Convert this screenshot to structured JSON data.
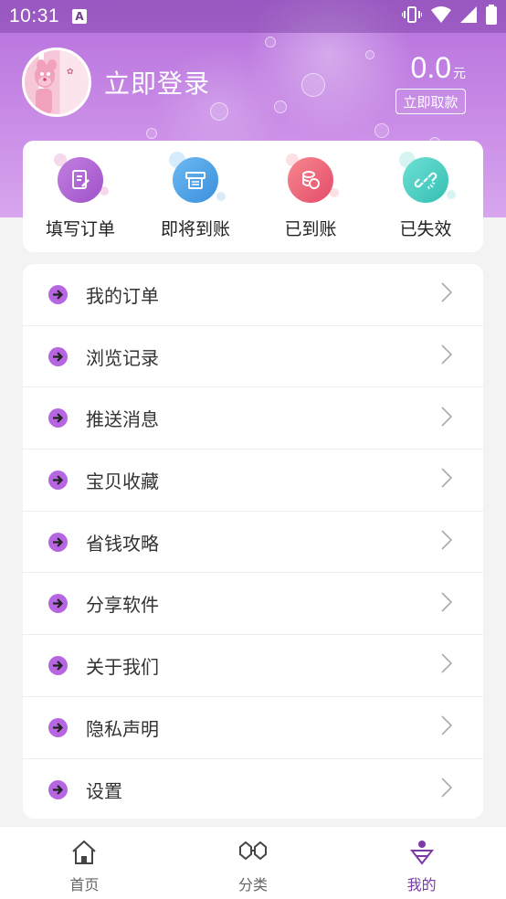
{
  "status_bar": {
    "time": "10:31",
    "notification_icon": "A"
  },
  "header": {
    "login_label": "立即登录",
    "balance_amount": "0.0",
    "balance_unit": "元",
    "withdraw_label": "立即取款",
    "accent_color": "#b56fdc"
  },
  "order_status": [
    {
      "label": "填写订单",
      "icon": "edit-order-icon",
      "color": "#b46bd6"
    },
    {
      "label": "即将到账",
      "icon": "printer-icon",
      "color": "#4fa7e8"
    },
    {
      "label": "已到账",
      "icon": "coins-icon",
      "color": "#f0617a"
    },
    {
      "label": "已失效",
      "icon": "broken-link-icon",
      "color": "#4fd1c5"
    }
  ],
  "menu": [
    {
      "label": "我的订单"
    },
    {
      "label": "浏览记录"
    },
    {
      "label": "推送消息"
    },
    {
      "label": "宝贝收藏"
    },
    {
      "label": "省钱攻略"
    },
    {
      "label": "分享软件"
    },
    {
      "label": "关于我们"
    },
    {
      "label": "隐私声明"
    },
    {
      "label": "设置"
    }
  ],
  "bottom_nav": [
    {
      "label": "首页",
      "icon": "home-icon"
    },
    {
      "label": "分类",
      "icon": "category-icon"
    },
    {
      "label": "我的",
      "icon": "profile-icon",
      "active": true
    }
  ]
}
